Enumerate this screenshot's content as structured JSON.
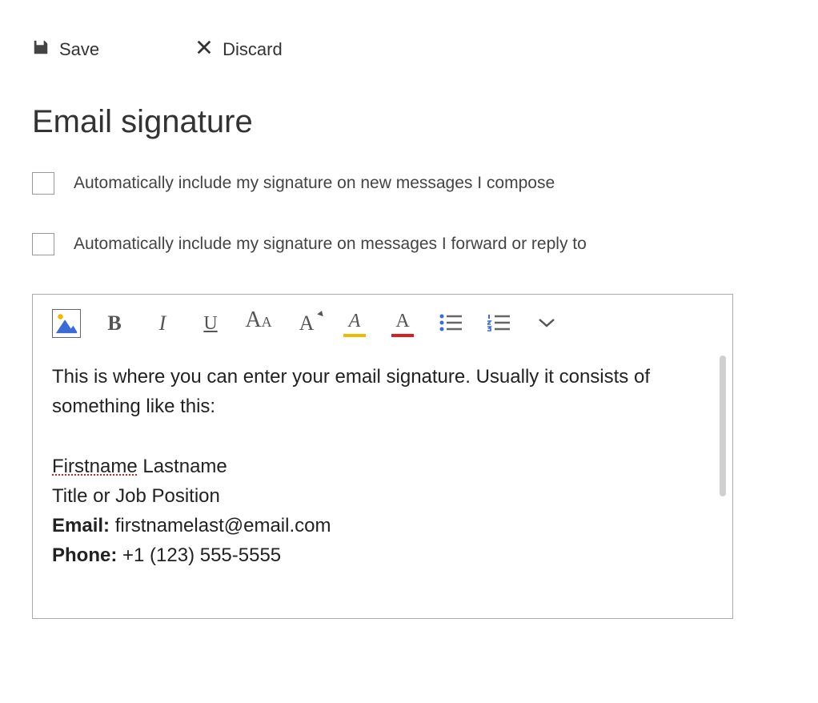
{
  "actions": {
    "save_label": "Save",
    "discard_label": "Discard"
  },
  "title": "Email signature",
  "checkboxes": {
    "new_messages": {
      "label": "Automatically include my signature on new messages I compose",
      "checked": false
    },
    "reply_forward": {
      "label": "Automatically include my signature on messages I forward or reply to",
      "checked": false
    }
  },
  "toolbar": {
    "icons": {
      "image": "image-icon",
      "bold": "B",
      "italic": "I",
      "underline": "U",
      "font_size_big": "A",
      "font_size_small": "A",
      "font_family": "A",
      "highlight": "A",
      "font_color": "A",
      "bullets": "bullet-list-icon",
      "numbered": "numbered-list-icon",
      "more": "chevron-down-icon"
    },
    "colors": {
      "highlight_bar": "#f0b800",
      "font_color_bar": "#d92020",
      "bullet_fill": "#3a6bd6",
      "line_stroke": "#666"
    }
  },
  "signature": {
    "intro": "This is where you can enter your email signature. Usually it consists of something like this:",
    "firstname": "Firstname",
    "lastname": " Lastname",
    "title_line": "Title or Job Position",
    "email_label": "Email:",
    "email_value": " firstnamelast@email.com",
    "phone_label": "Phone:",
    "phone_value": " +1 (123) 555-5555"
  }
}
